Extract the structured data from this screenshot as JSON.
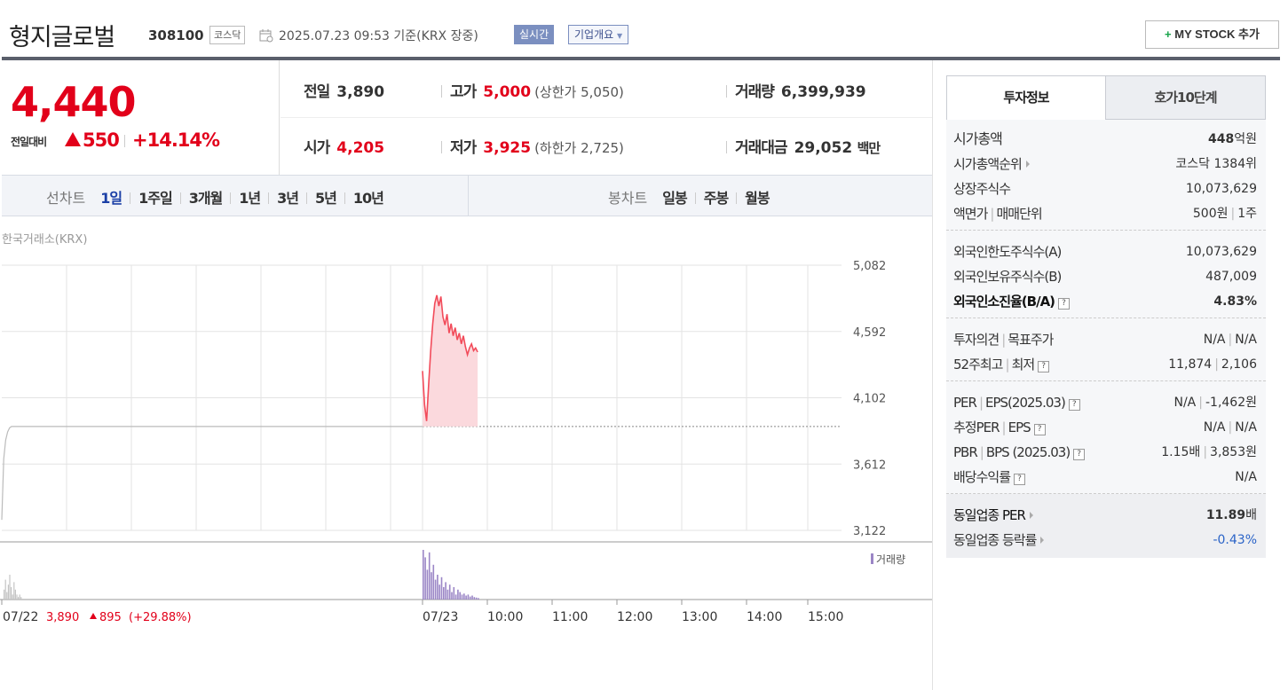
{
  "header": {
    "name": "형지글로벌",
    "code": "308100",
    "market": "코스닥",
    "datetime": "2025.07.23 09:53",
    "basis": "기준(KRX 장중)",
    "realtime": "실시간",
    "company_info": "기업개요",
    "mystock": "MY STOCK 추가",
    "mystock_plus": "+"
  },
  "price": {
    "current": "4,440",
    "change_label": "전일대비",
    "change": "550",
    "change_pct": "+14.14%"
  },
  "stats": {
    "prev_close_label": "전일",
    "prev_close": "3,890",
    "high_label": "고가",
    "high": "5,000",
    "upper_limit": "(상한가 5,050)",
    "volume_label": "거래량",
    "volume": "6,399,939",
    "open_label": "시가",
    "open": "4,205",
    "low_label": "저가",
    "low": "3,925",
    "lower_limit": "(하한가 2,725)",
    "amount_label": "거래대금",
    "amount": "29,052",
    "amount_unit": "백만"
  },
  "chart_tabs": {
    "line_caption": "선차트",
    "line_items": [
      "1일",
      "1주일",
      "3개월",
      "1년",
      "3년",
      "5년",
      "10년"
    ],
    "line_active": "1일",
    "candle_caption": "봉차트",
    "candle_items": [
      "일봉",
      "주봉",
      "월봉"
    ]
  },
  "chart_data": {
    "type": "line",
    "source": "한국거래소(KRX)",
    "yticks": [
      "5,082",
      "4,592",
      "4,102",
      "3,612",
      "3,122"
    ],
    "ylim": [
      3122,
      5082
    ],
    "xticks": [
      "07/22",
      "07/23",
      "10:00",
      "11:00",
      "12:00",
      "13:00",
      "14:00",
      "15:00"
    ],
    "prev_close": 3890,
    "prev_day_series": [
      3200,
      3650,
      3790,
      3850,
      3880,
      3890,
      3890,
      3890
    ],
    "series": [
      {
        "values": [
          4300,
          4050,
          3930,
          4200,
          4450,
          4650,
          4800,
          4860,
          4780,
          4850,
          4700,
          4640,
          4720,
          4580,
          4650,
          4560,
          4620,
          4530,
          4580,
          4500,
          4560,
          4480,
          4420,
          4470,
          4500,
          4450,
          4470,
          4440
        ]
      }
    ],
    "volume_label": "거래량",
    "prev_day_volume": [
      0.2,
      0.4,
      0.15,
      0.3,
      0.5,
      0.25,
      0.1,
      0.35,
      0.2,
      0.1,
      0.05,
      0.1,
      0.05
    ],
    "volume": [
      1.0,
      0.85,
      0.6,
      0.95,
      0.55,
      0.7,
      0.4,
      0.5,
      0.3,
      0.45,
      0.25,
      0.35,
      0.2,
      0.3,
      0.15,
      0.25,
      0.1,
      0.2,
      0.15,
      0.1,
      0.12,
      0.08,
      0.1,
      0.06,
      0.08,
      0.05,
      0.04,
      0.03
    ],
    "prev_day_summary": {
      "close": "3,890",
      "change": "895",
      "pct": "(+29.88%)"
    }
  },
  "right_panel": {
    "tab1": "투자정보",
    "tab2": "호가10단계",
    "sec1": [
      {
        "label": "시가총액",
        "value": "448",
        "unit": "억원",
        "bold_label": true
      },
      {
        "label": "시가총액순위",
        "value": "코스닥 1384위",
        "arrow": true
      },
      {
        "label": "상장주식수",
        "value": "10,073,629"
      },
      {
        "label": "액면가",
        "label2": "매매단위",
        "value": "500원",
        "value2": "1주"
      }
    ],
    "sec2": [
      {
        "label": "외국인한도주식수(A)",
        "value": "10,073,629"
      },
      {
        "label": "외국인보유주식수(B)",
        "value": "487,009"
      },
      {
        "label": "외국인소진율(B/A)",
        "value": "4.83%"
      }
    ],
    "sec3": [
      {
        "label": "투자의견",
        "label2": "목표주가",
        "value": "N/A",
        "value2": "N/A"
      },
      {
        "label": "52주최고",
        "label2": "최저",
        "value": "11,874",
        "value2": "2,106"
      }
    ],
    "sec4": [
      {
        "label": "PER",
        "label2": "EPS(2025.03)",
        "value": "N/A",
        "value2": "-1,462원"
      },
      {
        "label": "추정PER",
        "label2": "EPS",
        "value": "N/A",
        "value2": "N/A"
      },
      {
        "label": "PBR",
        "label2": "BPS (2025.03)",
        "value": "1.15배",
        "value2": "3,853원"
      },
      {
        "label": "배당수익률",
        "value": "N/A"
      }
    ],
    "sec5": [
      {
        "label": "동일업종 PER",
        "value": "11.89",
        "unit": "배"
      },
      {
        "label": "동일업종 등락률",
        "value": "-0.43%"
      }
    ],
    "help_glyph": "?"
  },
  "colors": {
    "up": "#e2001a",
    "line": "#f24b5a",
    "fill": "#fbd9dd",
    "volume": "#9b86c6",
    "grid": "#e3e3e3",
    "active_tab": "#1b3fa6"
  }
}
